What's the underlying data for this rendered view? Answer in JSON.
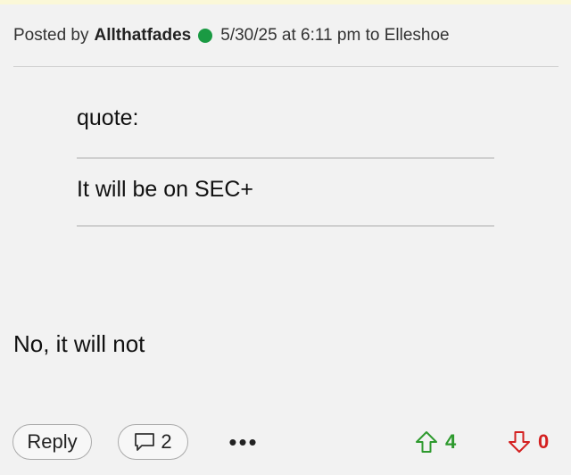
{
  "post": {
    "posted_by_label": "Posted by",
    "author": "Allthatfades",
    "timestamp": "5/30/25 at 6:11 pm",
    "to_label": "to",
    "recipient": "Elleshoe",
    "online_status_color": "#1a9a43"
  },
  "quote": {
    "label": "quote:",
    "text": "It will be on SEC+"
  },
  "body": "No, it will not",
  "actions": {
    "reply_label": "Reply",
    "comments_count": "2",
    "more_label": "•••",
    "upvotes": "4",
    "downvotes": "0",
    "up_color": "#2e9a2e",
    "down_color": "#d42020"
  }
}
